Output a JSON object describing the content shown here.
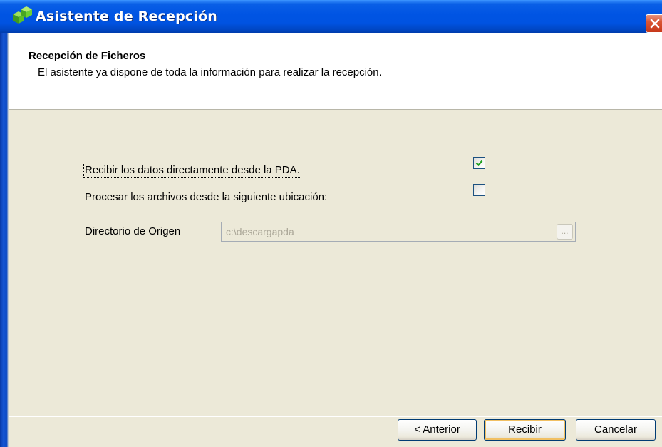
{
  "window": {
    "title": "Asistente de Recepción"
  },
  "header": {
    "title": "Recepción de Ficheros",
    "subtitle": "El asistente ya dispone de toda la información para realizar la recepción."
  },
  "options": {
    "receive_pda": {
      "label": "Recibir los datos directamente desde la PDA.",
      "checked": true
    },
    "process_files": {
      "label": "Procesar los archivos desde la siguiente ubicación:",
      "checked": false
    }
  },
  "directory": {
    "label": "Directorio de Origen",
    "value": "c:\\descargapda",
    "browse_label": "...",
    "enabled": false
  },
  "buttons": {
    "back": "< Anterior",
    "receive": "Recibir",
    "cancel": "Cancelar"
  },
  "icons": {
    "app": "green-cubes-icon",
    "close": "close-icon",
    "check": "checkmark-icon"
  },
  "colors": {
    "titlebar": "#0054e3",
    "close": "#d95534",
    "background": "#ece9d8",
    "check": "#21a121",
    "disabled_text": "#aca899"
  }
}
